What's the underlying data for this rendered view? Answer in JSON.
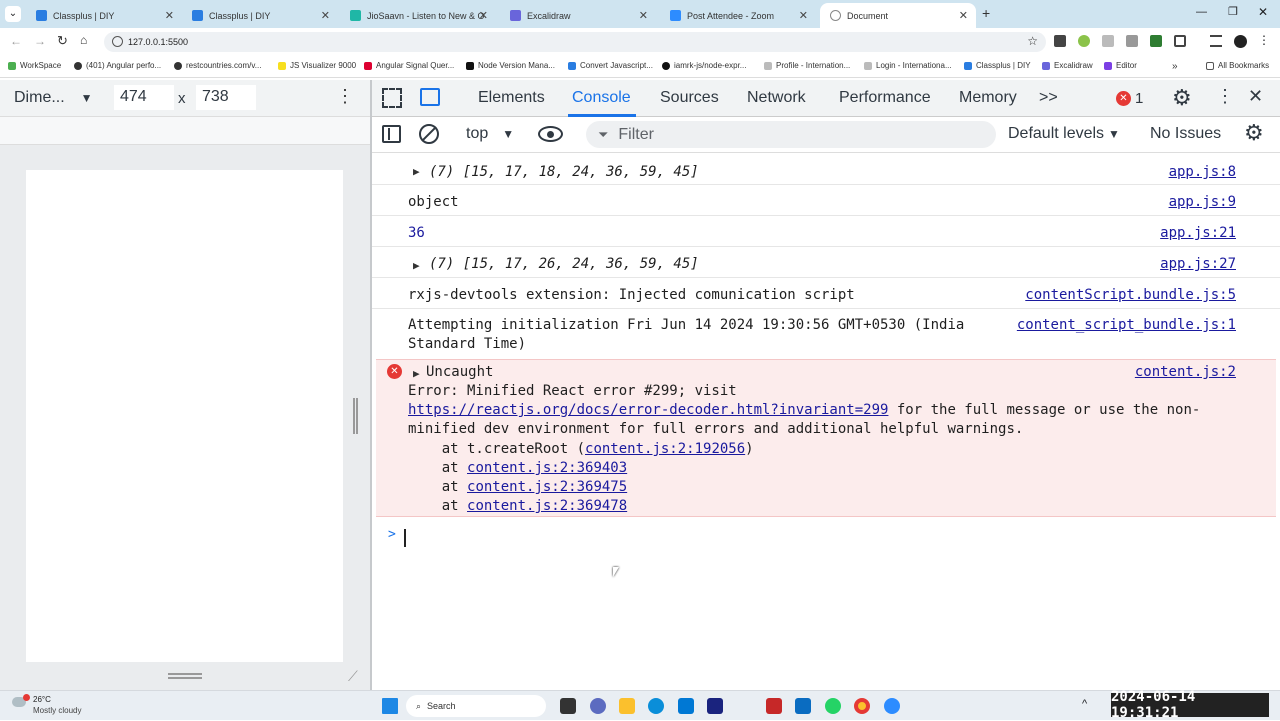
{
  "browser": {
    "tabs": [
      {
        "title": "Classplus | DIY",
        "color": "#2a7de1"
      },
      {
        "title": "Classplus | DIY",
        "color": "#2a7de1"
      },
      {
        "title": "JioSaavn - Listen to New & Old",
        "color": "#1fb7a6"
      },
      {
        "title": "Excalidraw",
        "color": "#6965db"
      },
      {
        "title": "Post Attendee - Zoom",
        "color": "#2d8cff"
      },
      {
        "title": "Document",
        "color": "#888888"
      }
    ],
    "url": "127.0.0.1:5500",
    "bookmarks": [
      {
        "label": "WorkSpace",
        "color": "#4caf50"
      },
      {
        "label": "(401) Angular perfo...",
        "color": "#333"
      },
      {
        "label": "restcountries.com/v...",
        "color": "#333"
      },
      {
        "label": "JS Visualizer 9000",
        "color": "#f7df1e"
      },
      {
        "label": "Angular Signal Quer...",
        "color": "#dd0031"
      },
      {
        "label": "Node Version Mana...",
        "color": "#111"
      },
      {
        "label": "Convert Javascript...",
        "color": "#2a7de1"
      },
      {
        "label": "iamrk-js/node-expr...",
        "color": "#111"
      },
      {
        "label": "Profile - Internation...",
        "color": "#bbb"
      },
      {
        "label": "Login - Internationa...",
        "color": "#bbb"
      },
      {
        "label": "Classplus | DIY",
        "color": "#2a7de1"
      },
      {
        "label": "Excalidraw",
        "color": "#6965db"
      },
      {
        "label": "Editor",
        "color": "#7b3fe4"
      }
    ],
    "all_bookmarks": "All Bookmarks"
  },
  "device_toolbar": {
    "dimensions_label": "Dime...",
    "width": "474",
    "times": "x",
    "height": "738"
  },
  "devtools": {
    "tabs": [
      "Elements",
      "Console",
      "Sources",
      "Network",
      "Performance",
      "Memory"
    ],
    "active_tab": "Console",
    "more": ">>",
    "error_count": "1",
    "context": "top",
    "filter_placeholder": "Filter",
    "levels": "Default levels",
    "issues": "No Issues"
  },
  "console": {
    "rows": [
      {
        "text": "(7) [15, 17, 18, 24, 36, 59, 45]",
        "src": "app.js:8"
      },
      {
        "text": "object",
        "src": "app.js:9"
      },
      {
        "text": "36",
        "src": "app.js:21"
      },
      {
        "text": "(7) [15, 17, 26, 24, 36, 59, 45]",
        "src": "app.js:27"
      },
      {
        "text": "rxjs-devtools extension: Injected comunication script",
        "src": "contentScript.bundle.js:5"
      },
      {
        "text1": "Attempting initialization Fri Jun 14 2024 19:30:56 GMT+0530 (India",
        "text2": "Standard Time)",
        "src": "content_script_bundle.js:1"
      }
    ],
    "error": {
      "title": "Uncaught",
      "src": "content.js:2",
      "line1": "Error: Minified React error #299; visit",
      "url": "https://reactjs.org/docs/error-decoder.html?invariant=299",
      "after_url": " for the full message or use the non-",
      "line3": "minified dev environment for full errors and additional helpful warnings.",
      "at1_pre": "    at t.createRoot (",
      "at1_link": "content.js:2:192056",
      "at1_post": ")",
      "at_prefix": "    at ",
      "at2": "content.js:2:369403",
      "at3": "content.js:2:369475",
      "at4": "content.js:2:369478"
    },
    "prompt": ">"
  },
  "taskbar": {
    "weather_temp": "26°C",
    "weather_desc": "Mostly cloudy",
    "search": "Search",
    "datetime": "2024-06-14 19:31:21"
  }
}
